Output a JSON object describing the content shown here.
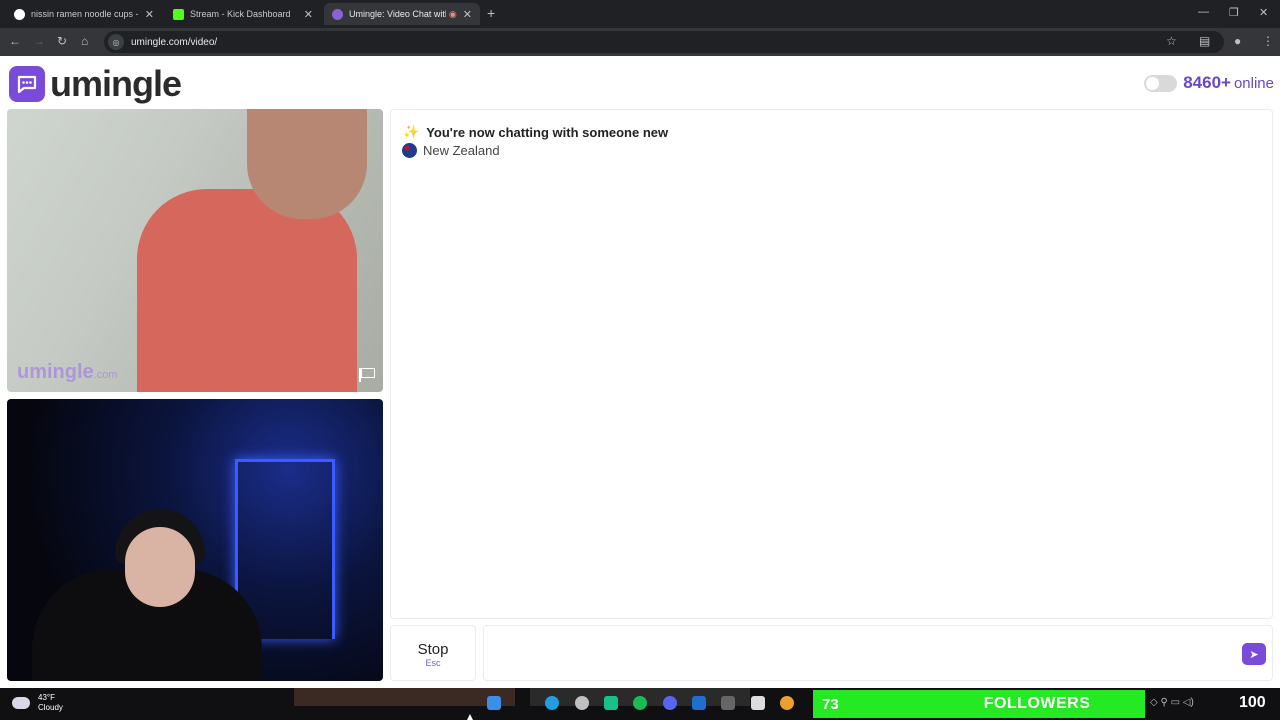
{
  "browser": {
    "tabs": [
      {
        "title": "nissin ramen noodle cups - Go",
        "favicon_color": "#ffffff",
        "active": false
      },
      {
        "title": "Stream - Kick Dashboard",
        "favicon_color": "#53fc18",
        "active": false
      },
      {
        "title": "Umingle: Video Chat with S",
        "favicon_color": "#8a63d2",
        "active": true
      }
    ],
    "url": "umingle.com/video/"
  },
  "app": {
    "logo_text": "umingle",
    "online_count": "8460+",
    "online_label": "online",
    "watermark_main": "umingle",
    "watermark_suffix": ".com",
    "brand_color": "#7a4bd8"
  },
  "chat": {
    "system_message": "You're now chatting with someone new",
    "country": "New Zealand",
    "stop_label": "Stop",
    "stop_shortcut": "Esc",
    "input_placeholder": ""
  },
  "taskbar": {
    "temperature": "43°F",
    "condition": "Cloudy",
    "followers_count": "73",
    "followers_label": "FOLLOWERS",
    "overlay_number": "100"
  }
}
